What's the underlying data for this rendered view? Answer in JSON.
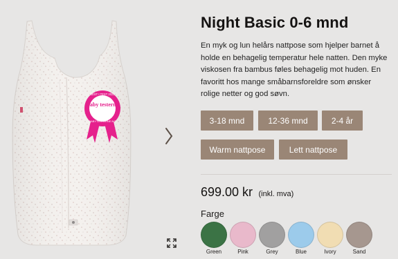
{
  "product": {
    "title": "Night Basic 0-6 mnd",
    "description": "En myk og lun helårs nattpose som hjelper barnet å holde en behagelig temperatur hele natten. Den myke viskosen fra bambus føles behagelig mot huden. En favoritt hos mange småbarnsforeldre som ønsker rolige netter og god søvn.",
    "badge": {
      "top_text": "BEST I TEST 2022",
      "brand": "Baby testerne",
      "bottom_text": "BABYTESTERNE.NO",
      "color": "#e5218c"
    },
    "size_options": [
      "3-18 mnd",
      "12-36 mnd",
      "2-4 år"
    ],
    "variant_options": [
      "Warm nattpose",
      "Lett nattpose"
    ],
    "price": "699.00 kr",
    "price_note": "(inkl. mva)",
    "color_label": "Farge",
    "colors": [
      {
        "name": "Green",
        "hex": "#3b7345"
      },
      {
        "name": "Pink",
        "hex": "#e9b9cb"
      },
      {
        "name": "Grey",
        "hex": "#a1a0a0"
      },
      {
        "name": "Blue",
        "hex": "#9ccbeb"
      },
      {
        "name": "Ivory",
        "hex": "#f1ddb3"
      },
      {
        "name": "Sand",
        "hex": "#a6978f"
      }
    ]
  },
  "gallery": {
    "next_icon": "chevron-right-icon",
    "expand_icon": "expand-icon"
  },
  "theme": {
    "button_color": "#9a8676",
    "background": "#e7e6e5"
  }
}
